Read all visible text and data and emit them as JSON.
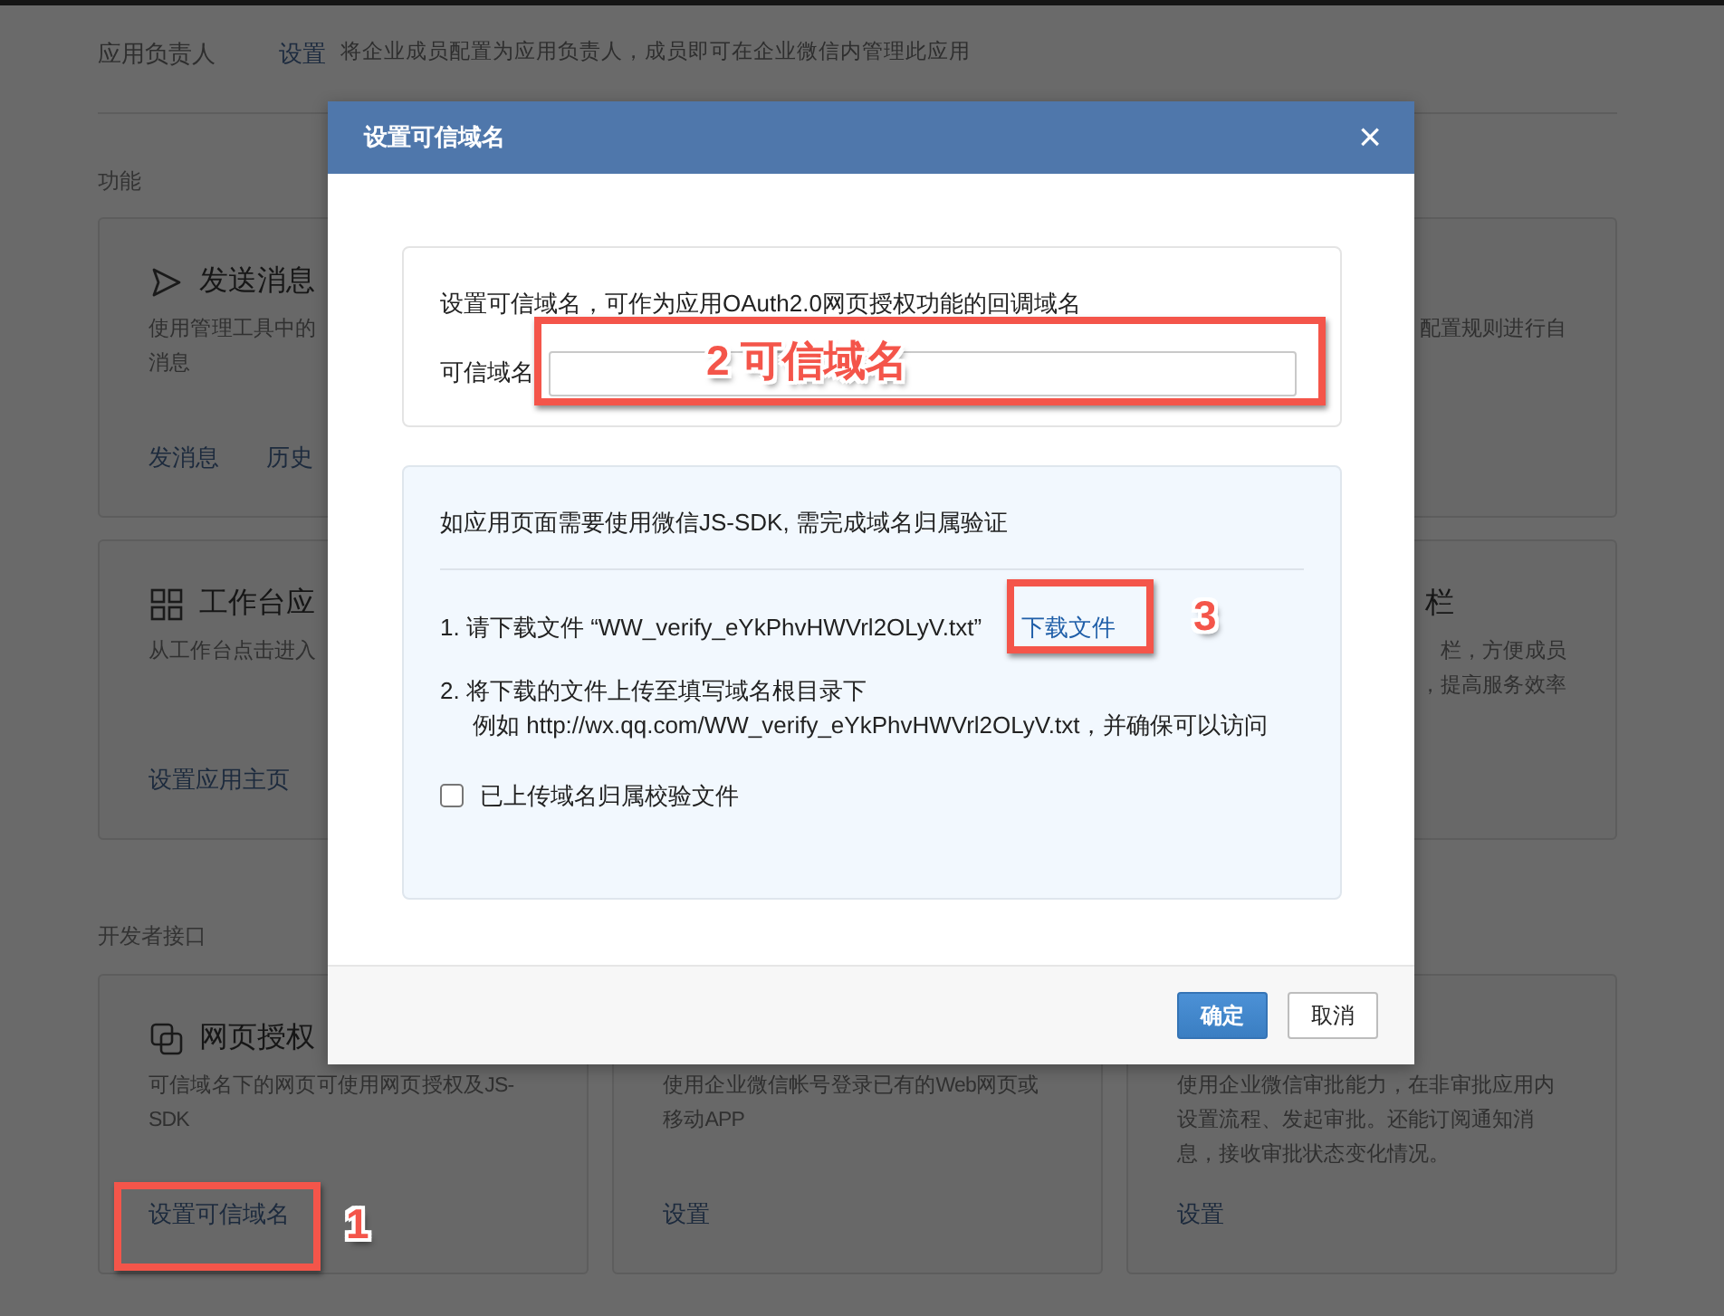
{
  "owner_row": {
    "label": "应用负责人",
    "link": "设置",
    "description": "将企业成员配置为应用负责人，成员即可在企业微信内管理此应用"
  },
  "sections": [
    {
      "title": "功能",
      "rows": [
        [
          {
            "kind": "send",
            "title": "发送消息",
            "description": [
              "使用管理工具中的",
              "消息"
            ],
            "links": [
              "发消息",
              "历史"
            ]
          },
          null,
          {
            "description": [
              "配置规则进行自"
            ]
          }
        ],
        [
          {
            "kind": "grid",
            "title": "工作台应",
            "description": [
              "从工作台点击进入"
            ],
            "links": [
              "设置应用主页"
            ]
          },
          null,
          {
            "title": "栏",
            "description": [
              "栏，方便成员",
              "，提高服务效率"
            ]
          }
        ]
      ]
    },
    {
      "title": "开发者接口",
      "rows": [
        [
          {
            "kind": "squares",
            "title": "网页授权",
            "description": [
              "可信域名下的网页可使用网页授权及JS-",
              "SDK"
            ],
            "links": [
              "设置可信域名"
            ]
          },
          {
            "description": [
              "使用企业微信帐号登录已有的Web网页或",
              "移动APP"
            ],
            "links": [
              "设置"
            ]
          },
          {
            "description": [
              "使用企业微信审批能力，在非审批应用内",
              "设置流程、发起审批。还能订阅通知消",
              "息，接收审批状态变化情况。"
            ],
            "links": [
              "设置"
            ]
          }
        ]
      ]
    }
  ],
  "dialog": {
    "title": "设置可信域名",
    "close": "×",
    "domain_box": {
      "intro": "设置可信域名，可作为应用OAuth2.0网页授权功能的回调域名",
      "label": "可信域名"
    },
    "verify_box": {
      "intro": "如应用页面需要使用微信JS-SDK, 需完成域名归属验证",
      "step_1": "1. 请下载文件 “WW_verify_eYkPhvHWVrl2OLyV.txt”",
      "download_link": "下载文件",
      "step_2": "2. 将下载的文件上传至填写域名根目录下",
      "example": "例如 http://wx.qq.com/WW_verify_eYkPhvHWVrl2OLyV.txt，并确保可以访问",
      "checkbox": {
        "label": "已上传域名归属校验文件",
        "checked": false
      }
    },
    "buttons": [
      {
        "label": "确定",
        "primary": true
      },
      {
        "label": "取消",
        "primary": false
      }
    ]
  },
  "annotations": [
    {
      "label": "1"
    },
    {
      "label": "2 可信域名"
    },
    {
      "label": "3"
    }
  ]
}
